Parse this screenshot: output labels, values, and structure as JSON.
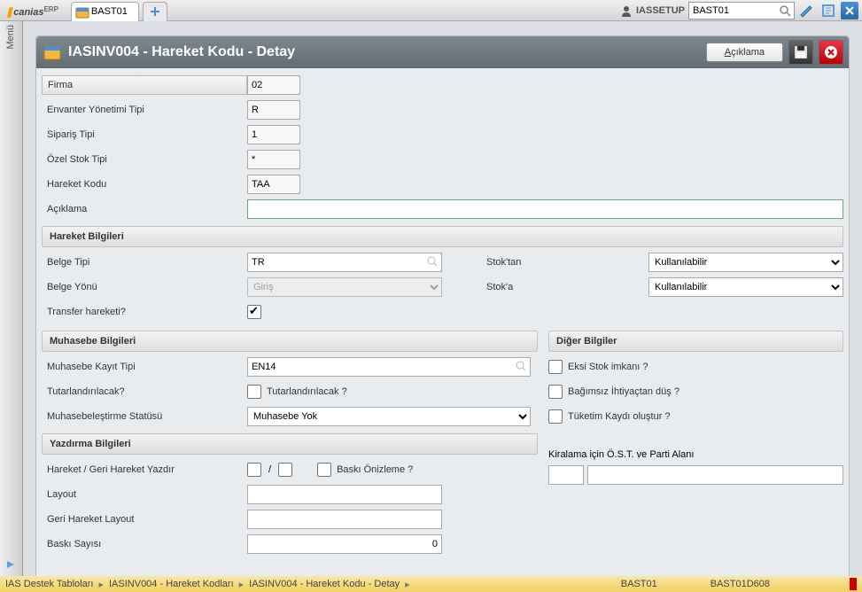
{
  "top": {
    "logo_main": "canias",
    "logo_sup": "ERP",
    "tab_title": "BAST01",
    "user": "IASSETUP",
    "search_value": "BAST01"
  },
  "menu_label": "Menü",
  "header": {
    "title": "IASINV004 - Hareket Kodu - Detay",
    "desc_button": "Açıklama"
  },
  "fields": {
    "firma": {
      "label": "Firma",
      "value": "02"
    },
    "env_tipi": {
      "label": "Envanter Yönetimi Tipi",
      "value": "R"
    },
    "siparis": {
      "label": "Sipariş Tipi",
      "value": "1"
    },
    "ozel_stok": {
      "label": "Özel Stok Tipi",
      "value": "*"
    },
    "hareket_kodu": {
      "label": "Hareket Kodu",
      "value": "TAA"
    },
    "aciklama": {
      "label": "Açıklama",
      "value": ""
    }
  },
  "sections": {
    "hareket": "Hareket Bilgileri",
    "muhasebe": "Muhasebe Bilgileri",
    "diger": "Diğer Bilgiler",
    "yazdirma": "Yazdırma Bilgileri"
  },
  "hareket": {
    "belge_tipi": {
      "label": "Belge Tipi",
      "value": "TR"
    },
    "belge_yonu": {
      "label": "Belge Yönü",
      "selected": "Giriş"
    },
    "transfer": {
      "label": "Transfer hareketi?",
      "checked": true
    },
    "stoktan": {
      "label": "Stok'tan",
      "selected": "Kullanılabilir"
    },
    "stoka": {
      "label": "Stok'a",
      "selected": "Kullanılabilir"
    }
  },
  "muhasebe": {
    "kayit_tipi": {
      "label": "Muhasebe Kayıt Tipi",
      "value": "EN14"
    },
    "tutarlandir": {
      "label": "Tutarlandırılacak?",
      "chk_label": "Tutarlandırılacak ?"
    },
    "status": {
      "label": "Muhasebeleştirme Statüsü",
      "selected": "Muhasebe Yok"
    }
  },
  "diger": {
    "eksi_stok": "Eksi Stok imkanı ?",
    "bagimsiz": "Bağımsız İhtiyaçtan düş ?",
    "tuketim": "Tüketim Kaydı oluştur ?",
    "kiralama": "Kiralama için Ö.S.T. ve Parti Alanı"
  },
  "yazdirma": {
    "hareket_yaz": "Hareket / Geri Hareket Yazdır",
    "baski_on": "Baskı Önizleme ?",
    "layout": "Layout",
    "geri_layout": "Geri Hareket Layout",
    "baski_sayisi": {
      "label": "Baskı Sayısı",
      "value": "0"
    },
    "slash": "/"
  },
  "breadcrumb": {
    "c1": "IAS Destek Tabloları",
    "c2": "IASINV004 - Hareket Kodları",
    "c3": "IASINV004 - Hareket Kodu - Detay"
  },
  "status": {
    "s1": "BAST01",
    "s2": "BAST01D608"
  }
}
